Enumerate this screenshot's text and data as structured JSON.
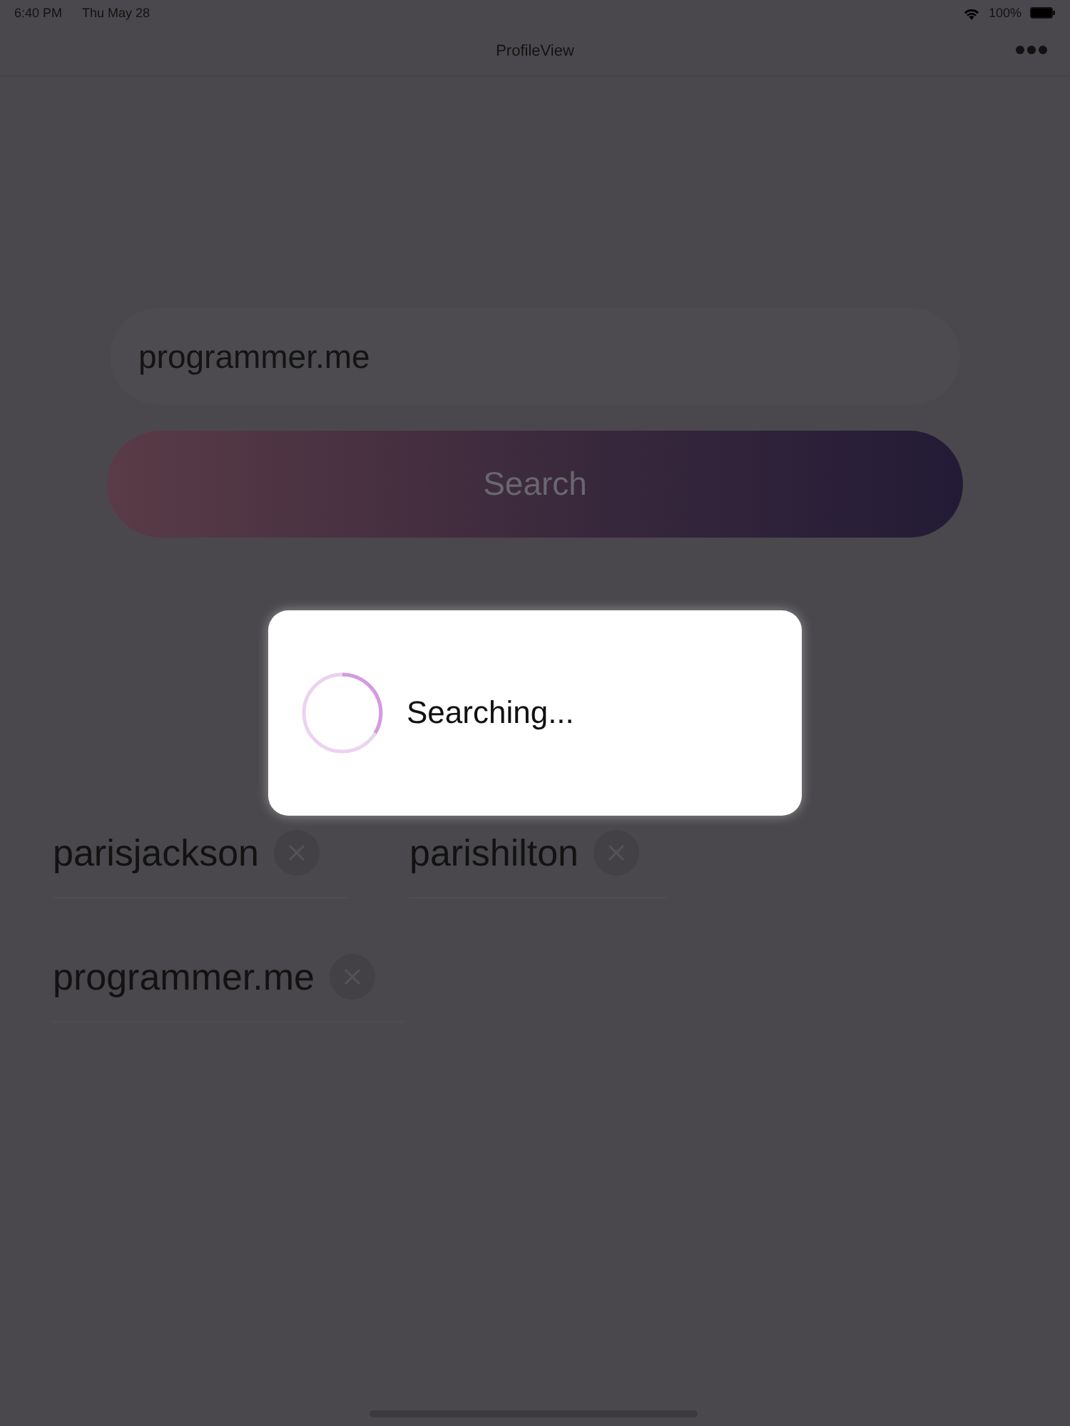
{
  "status_bar": {
    "time": "6:40 PM",
    "date": "Thu May 28",
    "battery": "100%"
  },
  "nav_bar": {
    "title": "ProfileView"
  },
  "search_field": {
    "value": "programmer.me"
  },
  "search_button": {
    "label": "Search"
  },
  "history": [
    {
      "label": "parisjackson"
    },
    {
      "label": "parishilton"
    },
    {
      "label": "programmer.me"
    }
  ],
  "loading_dialog": {
    "message": "Searching..."
  }
}
